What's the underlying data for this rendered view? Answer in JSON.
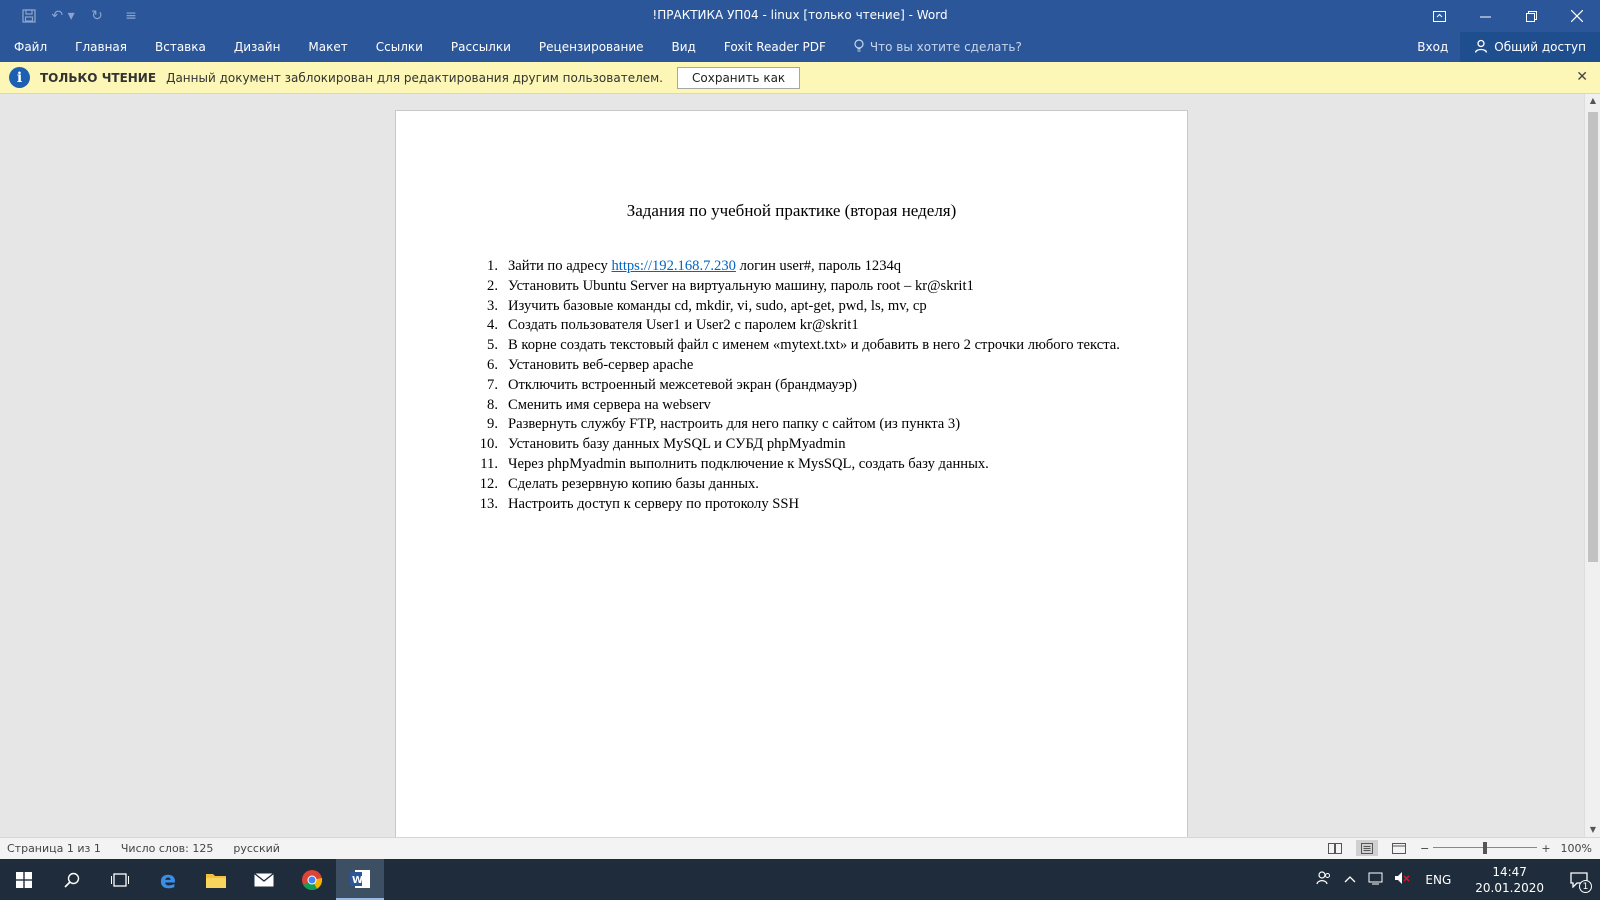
{
  "window": {
    "title": "!ПРАКТИКА УП04 - linux [только чтение] - Word"
  },
  "qat": {
    "save_icon": "save-icon",
    "undo_icon": "undo-icon",
    "redo_icon": "redo-icon",
    "customize_icon": "customize-qat-icon"
  },
  "ribbon": {
    "tabs": [
      "Файл",
      "Главная",
      "Вставка",
      "Дизайн",
      "Макет",
      "Ссылки",
      "Рассылки",
      "Рецензирование",
      "Вид",
      "Foxit Reader PDF"
    ],
    "tell_me": "Что вы хотите сделать?",
    "signin": "Вход",
    "share": "Общий доступ"
  },
  "infobar": {
    "title": "ТОЛЬКО ЧТЕНИЕ",
    "message": "Данный документ заблокирован для редактирования другим пользователем.",
    "save_as": "Сохранить как"
  },
  "document": {
    "title": "Задания по учебной практике (вторая неделя)",
    "tasks": [
      {
        "num": "1.",
        "pre": "Зайти по адресу ",
        "link": "https://192.168.7.230",
        "post": " логин user#, пароль 1234q"
      },
      {
        "num": "2.",
        "pre": "Установить Ubuntu Server на виртуальную машину, пароль root – kr@skrit1"
      },
      {
        "num": "3.",
        "pre": "Изучить базовые команды cd, mkdir, vi, sudo, apt-get, pwd, ls, mv, cp"
      },
      {
        "num": "4.",
        "pre": "Создать пользователя User1 и User2  с паролем kr@skrit1"
      },
      {
        "num": "5.",
        "pre": "В корне создать текстовый файл с именем «mytext.txt» и добавить в него 2 строчки любого текста."
      },
      {
        "num": "6.",
        "pre": "Установить веб-сервер apache"
      },
      {
        "num": "7.",
        "pre": "Отключить встроенный межсетевой экран (брандмауэр)"
      },
      {
        "num": "8.",
        "pre": "Сменить имя сервера на webserv"
      },
      {
        "num": "9.",
        "pre": "Развернуть службу FTP, настроить для него папку с сайтом (из пункта 3)"
      },
      {
        "num": "10.",
        "pre": "Установить базу данных MySQL и СУБД phpMyadmin"
      },
      {
        "num": "11.",
        "pre": "Через phpMyadmin выполнить подключение к MysSQL, создать базу данных."
      },
      {
        "num": "12.",
        "pre": "Сделать резервную копию базы данных."
      },
      {
        "num": "13.",
        "pre": "Настроить доступ к серверу по протоколу SSH"
      }
    ]
  },
  "status": {
    "page": "Страница 1 из 1",
    "words": "Число слов: 125",
    "lang": "русский",
    "zoom": "100%",
    "zoom_level": 1.0
  },
  "taskbar": {
    "lang": "ENG",
    "time": "14:47",
    "date": "20.01.2020",
    "notifications": "1"
  },
  "colors": {
    "word_blue": "#2b579a",
    "infobar_bg": "#fcf7b6",
    "link": "#0563c1",
    "taskbar": "#1f2c3b"
  }
}
